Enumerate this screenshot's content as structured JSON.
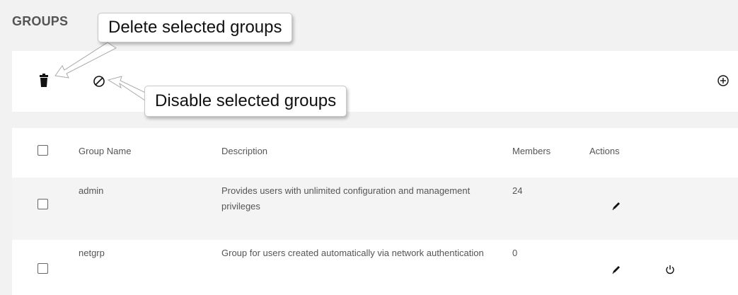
{
  "page": {
    "title": "GROUPS"
  },
  "toolbar": {
    "delete_icon": "trash-icon",
    "disable_icon": "disable-icon",
    "add_icon": "plus-circle-icon"
  },
  "callouts": {
    "delete": "Delete selected groups",
    "disable": "Disable selected groups"
  },
  "table": {
    "headers": {
      "name": "Group Name",
      "description": "Description",
      "members": "Members",
      "actions": "Actions"
    },
    "rows": [
      {
        "name": "admin",
        "description": "Provides users with unlimited configuration and management privileges",
        "members": "24",
        "actions": [
          "edit-icon"
        ]
      },
      {
        "name": "netgrp",
        "description": "Group for users created automatically via network authentication",
        "members": "0",
        "actions": [
          "edit-icon",
          "power-icon"
        ]
      }
    ]
  },
  "colors": {
    "background": "#f2f2f2",
    "panel": "#ffffff",
    "text": "#555555",
    "row_alt": "#f4f4f4"
  }
}
